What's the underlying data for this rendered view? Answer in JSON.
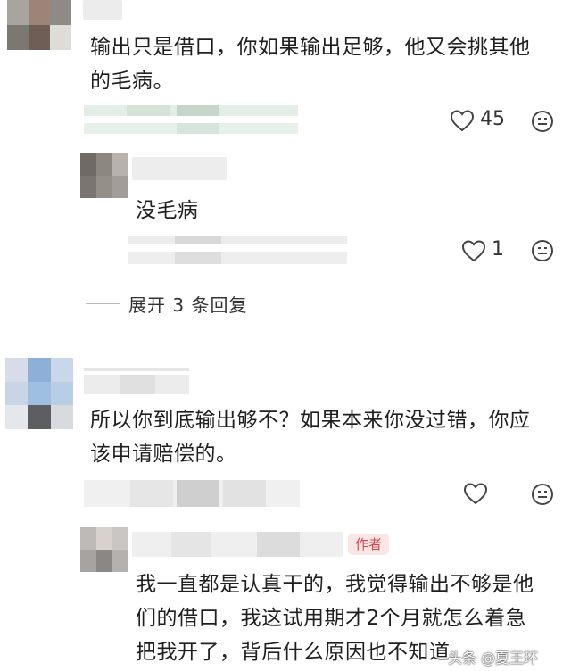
{
  "comments": [
    {
      "text_line1": "输出只是借口，你如果输出足够，他又会挑其他",
      "text_line2": "的毛病。",
      "likes": "45",
      "reply": {
        "text": "没毛病",
        "likes": "1"
      },
      "expand_label": "展开 3 条回复"
    },
    {
      "text_line1": "所以你到底输出够不？如果本来你没过错，你应",
      "text_line2": "该申请赔偿的。",
      "likes": "",
      "reply": {
        "author_tag": "作者",
        "text_line1": "我一直都是认真干的，我觉得输出不够是他",
        "text_line2": "们的借口，我这试用期才2个月就怎么着急",
        "text_line3": "把我开了，背后什么原因也不知道"
      }
    }
  ],
  "watermark": "头条 @夏王环",
  "icons": [
    "heart-icon",
    "emoji-icon"
  ],
  "colors": {
    "tag_bg": "#fbe6e6",
    "tag_text": "#d8434a",
    "icon": "#444444"
  }
}
